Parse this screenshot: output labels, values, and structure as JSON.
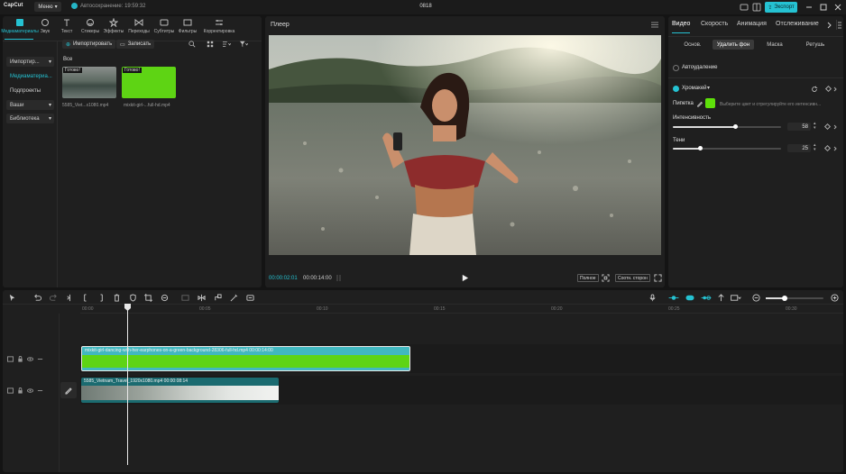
{
  "app": {
    "logo": "CapCut",
    "menu_label": "Меню",
    "autosave": "Автосохранение: 19:59:32",
    "project_title": "0818",
    "export_label": "Экспорт",
    "accent": "#25c2d2"
  },
  "media": {
    "tabs": [
      {
        "label": "Медиаматериалы",
        "icon": "media-icon"
      },
      {
        "label": "Звук",
        "icon": "audio-icon"
      },
      {
        "label": "Текст",
        "icon": "text-icon"
      },
      {
        "label": "Стикеры",
        "icon": "sticker-icon"
      },
      {
        "label": "Эффекты",
        "icon": "effects-icon"
      },
      {
        "label": "Переходы",
        "icon": "transition-icon"
      },
      {
        "label": "Субтитры",
        "icon": "subtitles-icon"
      },
      {
        "label": "Фильтры",
        "icon": "filter-icon"
      },
      {
        "label": "Корректировка",
        "icon": "adjust-icon"
      }
    ],
    "side": [
      "Импортир...",
      "Медиаматериа...",
      "Подпроекты",
      "Ваши",
      "Библиотека"
    ],
    "import_label": "Импортировать",
    "record_label": "Записать",
    "filter_all": "Все",
    "items": [
      {
        "tag": "Готово!",
        "name": "5585_Viet...x1080.mp4"
      },
      {
        "tag": "Готово!",
        "name": "mixkit-girl-...full-hd.mp4"
      }
    ]
  },
  "player": {
    "title": "Плеер",
    "time_current": "00:00:02:01",
    "time_total": "00:00:14:00",
    "btn_full": "Полное",
    "btn_ratio": "Соотн. сторон"
  },
  "props": {
    "tabs": [
      "Видео",
      "Скорость",
      "Анимация",
      "Отслеживание"
    ],
    "subtabs": [
      "Основ.",
      "Удалить фон",
      "Маска",
      "Ретушь"
    ],
    "auto_remove": "Автоудаление",
    "chroma_key": "Хромакей",
    "pipette_label": "Пипетка",
    "pipette_hint": "Выберите цвет и отрегулируйте его интенсивн...",
    "pipette_color": "#5ee00a",
    "intensity_label": "Интенсивность",
    "intensity_value": "58",
    "intensity_fraction": 0.58,
    "shadow_label": "Тени",
    "shadow_value": "25",
    "shadow_fraction": 0.25
  },
  "timeline": {
    "ruler": [
      "00:00",
      "00:05",
      "00:10",
      "00:15",
      "00:20",
      "00:25",
      "00:30"
    ],
    "clip_green_label": "mixkit-girl-dancing-with-her-earphones-on-a-green-background-28306-full-hd.mp4   00:00:14:00",
    "clip_video_label": "5585_Vietnam_Travel_1920x1080.mp4   00:00:08:14",
    "clip_green_color": "#5ed414"
  }
}
